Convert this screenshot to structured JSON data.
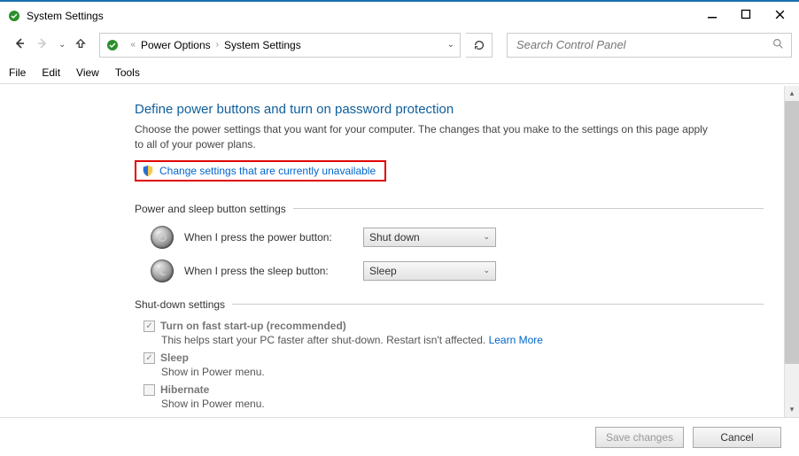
{
  "window": {
    "title": "System Settings"
  },
  "breadcrumb": {
    "level1": "Power Options",
    "level2": "System Settings"
  },
  "search": {
    "placeholder": "Search Control Panel"
  },
  "menu": {
    "file": "File",
    "edit": "Edit",
    "view": "View",
    "tools": "Tools"
  },
  "page": {
    "heading": "Define power buttons and turn on password protection",
    "description": "Choose the power settings that you want for your computer. The changes that you make to the settings on this page apply to all of your power plans.",
    "change_link": "Change settings that are currently unavailable"
  },
  "sections": {
    "power_sleep": {
      "label": "Power and sleep button settings",
      "power_button_label": "When I press the power button:",
      "power_button_value": "Shut down",
      "sleep_button_label": "When I press the sleep button:",
      "sleep_button_value": "Sleep"
    },
    "shutdown": {
      "label": "Shut-down settings",
      "fast_startup": {
        "label": "Turn on fast start-up (recommended)",
        "sub": "This helps start your PC faster after shut-down. Restart isn't affected. ",
        "learn": "Learn More",
        "checked": true
      },
      "sleep": {
        "label": "Sleep",
        "sub": "Show in Power menu.",
        "checked": true
      },
      "hibernate": {
        "label": "Hibernate",
        "sub": "Show in Power menu.",
        "checked": false
      }
    }
  },
  "footer": {
    "save": "Save changes",
    "cancel": "Cancel"
  }
}
